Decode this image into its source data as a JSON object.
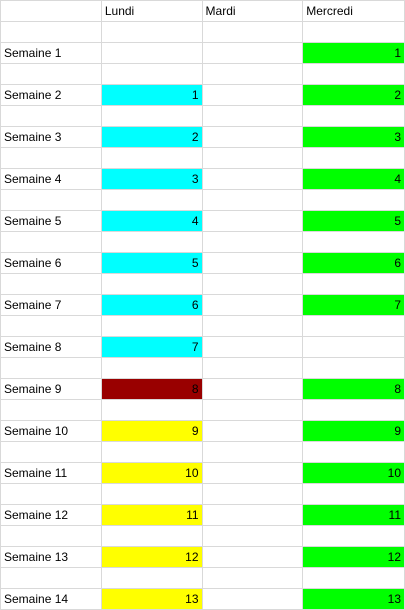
{
  "colors": {
    "cyan": "#00ffff",
    "green": "#00ff00",
    "yellow": "#ffff00",
    "darkred": "#990000",
    "gridline": "#d9d9d9"
  },
  "header": {
    "col_a": "",
    "col_b": "Lundi",
    "col_c": "Mardi",
    "col_d": "Mercredi"
  },
  "rows": [
    {
      "label": "Semaine 1",
      "lundi": "",
      "lundi_fill": "",
      "mardi": "",
      "mercredi": "1",
      "mercredi_fill": "green"
    },
    {
      "label": "Semaine 2",
      "lundi": "1",
      "lundi_fill": "cyan",
      "mardi": "",
      "mercredi": "2",
      "mercredi_fill": "green"
    },
    {
      "label": "Semaine 3",
      "lundi": "2",
      "lundi_fill": "cyan",
      "mardi": "",
      "mercredi": "3",
      "mercredi_fill": "green"
    },
    {
      "label": "Semaine 4",
      "lundi": "3",
      "lundi_fill": "cyan",
      "mardi": "",
      "mercredi": "4",
      "mercredi_fill": "green"
    },
    {
      "label": "Semaine 5",
      "lundi": "4",
      "lundi_fill": "cyan",
      "mardi": "",
      "mercredi": "5",
      "mercredi_fill": "green"
    },
    {
      "label": "Semaine 6",
      "lundi": "5",
      "lundi_fill": "cyan",
      "mardi": "",
      "mercredi": "6",
      "mercredi_fill": "green"
    },
    {
      "label": "Semaine 7",
      "lundi": "6",
      "lundi_fill": "cyan",
      "mardi": "",
      "mercredi": "7",
      "mercredi_fill": "green"
    },
    {
      "label": "Semaine 8",
      "lundi": "7",
      "lundi_fill": "cyan",
      "mardi": "",
      "mercredi": "",
      "mercredi_fill": ""
    },
    {
      "label": "Semaine 9",
      "lundi": "8",
      "lundi_fill": "darkred",
      "mardi": "",
      "mercredi": "8",
      "mercredi_fill": "green"
    },
    {
      "label": "Semaine 10",
      "lundi": "9",
      "lundi_fill": "yellow",
      "mardi": "",
      "mercredi": "9",
      "mercredi_fill": "green"
    },
    {
      "label": "Semaine 11",
      "lundi": "10",
      "lundi_fill": "yellow",
      "mardi": "",
      "mercredi": "10",
      "mercredi_fill": "green"
    },
    {
      "label": "Semaine 12",
      "lundi": "11",
      "lundi_fill": "yellow",
      "mardi": "",
      "mercredi": "11",
      "mercredi_fill": "green"
    },
    {
      "label": "Semaine 13",
      "lundi": "12",
      "lundi_fill": "yellow",
      "mardi": "",
      "mercredi": "12",
      "mercredi_fill": "green"
    },
    {
      "label": "Semaine 14",
      "lundi": "13",
      "lundi_fill": "yellow",
      "mardi": "",
      "mercredi": "13",
      "mercredi_fill": "green"
    }
  ]
}
